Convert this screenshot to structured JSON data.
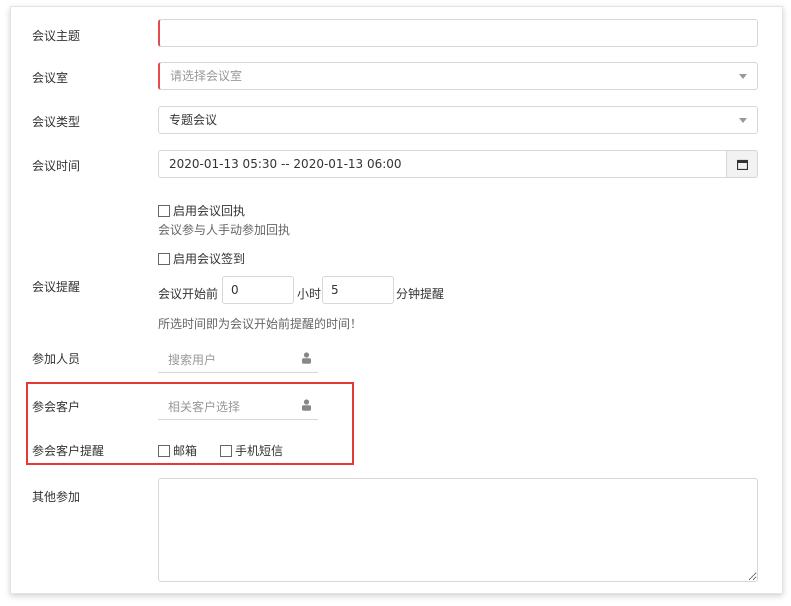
{
  "form": {
    "topic": {
      "label": "会议主题",
      "value": ""
    },
    "room": {
      "label": "会议室",
      "placeholder": "请选择会议室"
    },
    "type": {
      "label": "会议类型",
      "value": "专题会议"
    },
    "time": {
      "label": "会议时间",
      "value": "2020-01-13 05:30 -- 2020-01-13 06:00"
    },
    "receipt": {
      "checkbox_label": "启用会议回执",
      "hint": "会议参与人手动参加回执"
    },
    "signin": {
      "checkbox_label": "启用会议签到"
    },
    "reminder": {
      "label": "会议提醒",
      "prefix": "会议开始前",
      "hours_value": "0",
      "hours_unit": "小时",
      "minutes_value": "5",
      "minutes_suffix": "分钟提醒",
      "hint": "所选时间即为会议开始前提醒的时间！"
    },
    "participants": {
      "label": "参加人员",
      "placeholder": "搜索用户"
    },
    "customers": {
      "label": "参会客户",
      "placeholder": "相关客户选择"
    },
    "customer_reminder": {
      "label": "参会客户提醒",
      "email": "邮箱",
      "sms": "手机短信"
    },
    "others": {
      "label": "其他参加"
    }
  },
  "colors": {
    "required": "#e64a4a",
    "highlight": "#e53935"
  }
}
